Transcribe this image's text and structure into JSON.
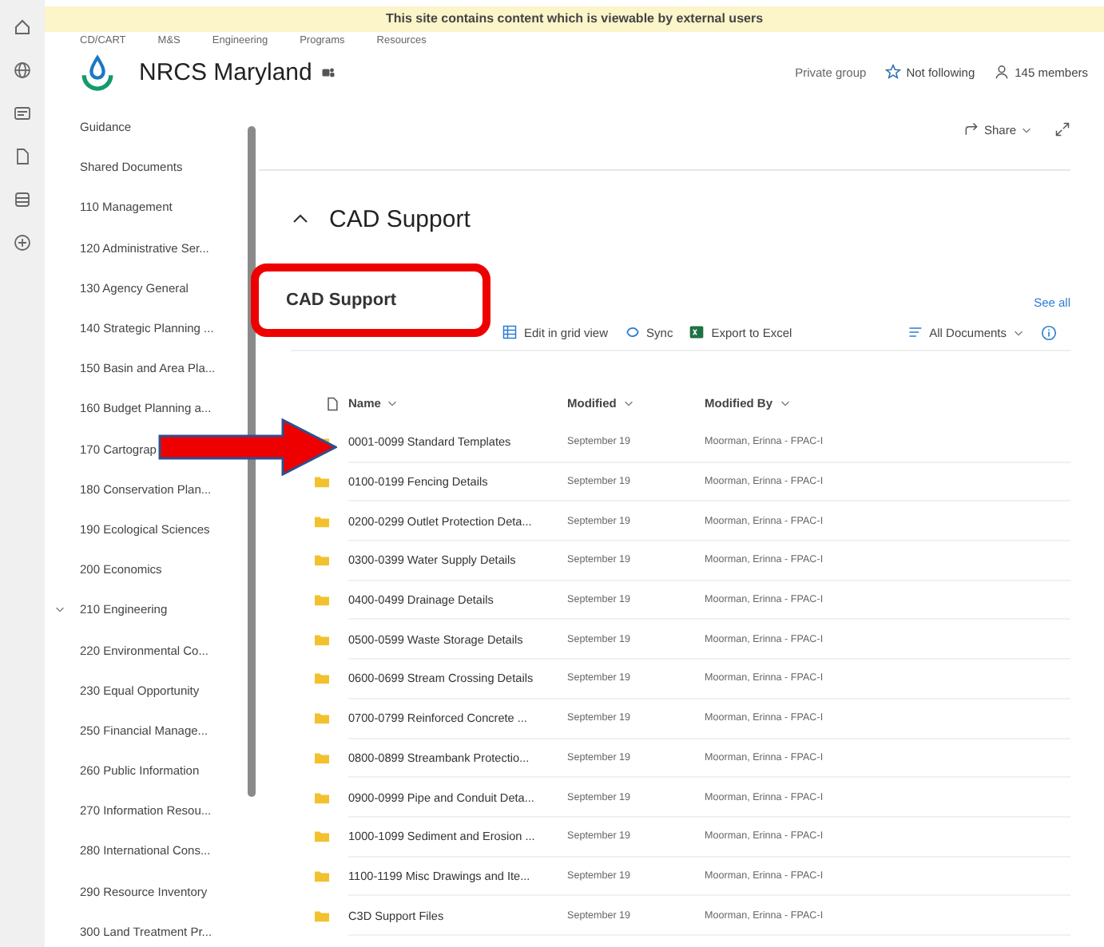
{
  "banner": "This site contains content which is viewable by external users",
  "top_nav": [
    "CD/CART",
    "M&S",
    "Engineering",
    "Programs",
    "Resources"
  ],
  "site": {
    "title": "NRCS Maryland",
    "privacy": "Private group",
    "follow": "Not following",
    "members": "145 members"
  },
  "sidebar": {
    "items": [
      {
        "label": "Guidance"
      },
      {
        "label": "Shared Documents"
      },
      {
        "label": "110 Management"
      },
      {
        "label": "120 Administrative Ser..."
      },
      {
        "label": "130 Agency General"
      },
      {
        "label": "140 Strategic Planning ..."
      },
      {
        "label": "150 Basin and Area Pla..."
      },
      {
        "label": "160 Budget Planning a..."
      },
      {
        "label": "170 Cartograp"
      },
      {
        "label": "180 Conservation Plan..."
      },
      {
        "label": "190 Ecological Sciences"
      },
      {
        "label": "200 Economics"
      },
      {
        "label": "210 Engineering",
        "expanded": true
      },
      {
        "label": "220 Environmental Co..."
      },
      {
        "label": "230 Equal Opportunity"
      },
      {
        "label": "250 Financial Manage..."
      },
      {
        "label": "260 Public Information"
      },
      {
        "label": "270 Information Resou..."
      },
      {
        "label": "280 International Cons..."
      },
      {
        "label": "290 Resource Inventory"
      },
      {
        "label": "300 Land Treatment Pr..."
      }
    ]
  },
  "share": "Share",
  "page_title": "CAD Support",
  "section": {
    "see_all": "See all",
    "toolbar": [
      "Edit in grid view",
      "Sync",
      "Export to Excel"
    ],
    "view": "All Documents"
  },
  "table": {
    "columns": [
      "Name",
      "Modified",
      "Modified By"
    ],
    "rows": [
      {
        "name": "0001-0099 Standard Templates",
        "modified": "September 19",
        "modified_by": "Moorman, Erinna - FPAC-I"
      },
      {
        "name": "0100-0199 Fencing Details",
        "modified": "September 19",
        "modified_by": "Moorman, Erinna - FPAC-I"
      },
      {
        "name": "0200-0299 Outlet Protection Deta...",
        "modified": "September 19",
        "modified_by": "Moorman, Erinna - FPAC-I"
      },
      {
        "name": "0300-0399 Water Supply Details",
        "modified": "September 19",
        "modified_by": "Moorman, Erinna - FPAC-I"
      },
      {
        "name": "0400-0499 Drainage Details",
        "modified": "September 19",
        "modified_by": "Moorman, Erinna - FPAC-I"
      },
      {
        "name": "0500-0599 Waste Storage Details",
        "modified": "September 19",
        "modified_by": "Moorman, Erinna - FPAC-I"
      },
      {
        "name": "0600-0699 Stream Crossing Details",
        "modified": "September 19",
        "modified_by": "Moorman, Erinna - FPAC-I"
      },
      {
        "name": "0700-0799 Reinforced Concrete ...",
        "modified": "September 19",
        "modified_by": "Moorman, Erinna - FPAC-I"
      },
      {
        "name": "0800-0899 Streambank Protectio...",
        "modified": "September 19",
        "modified_by": "Moorman, Erinna - FPAC-I"
      },
      {
        "name": "0900-0999 Pipe and Conduit Deta...",
        "modified": "September 19",
        "modified_by": "Moorman, Erinna - FPAC-I"
      },
      {
        "name": "1000-1099 Sediment and Erosion ...",
        "modified": "September 19",
        "modified_by": "Moorman, Erinna - FPAC-I"
      },
      {
        "name": "1100-1199 Misc Drawings and Ite...",
        "modified": "September 19",
        "modified_by": "Moorman, Erinna - FPAC-I"
      },
      {
        "name": "C3D Support Files",
        "modified": "September 19",
        "modified_by": "Moorman, Erinna - FPAC-I"
      }
    ]
  },
  "annotation": {
    "label": "CAD Support"
  }
}
